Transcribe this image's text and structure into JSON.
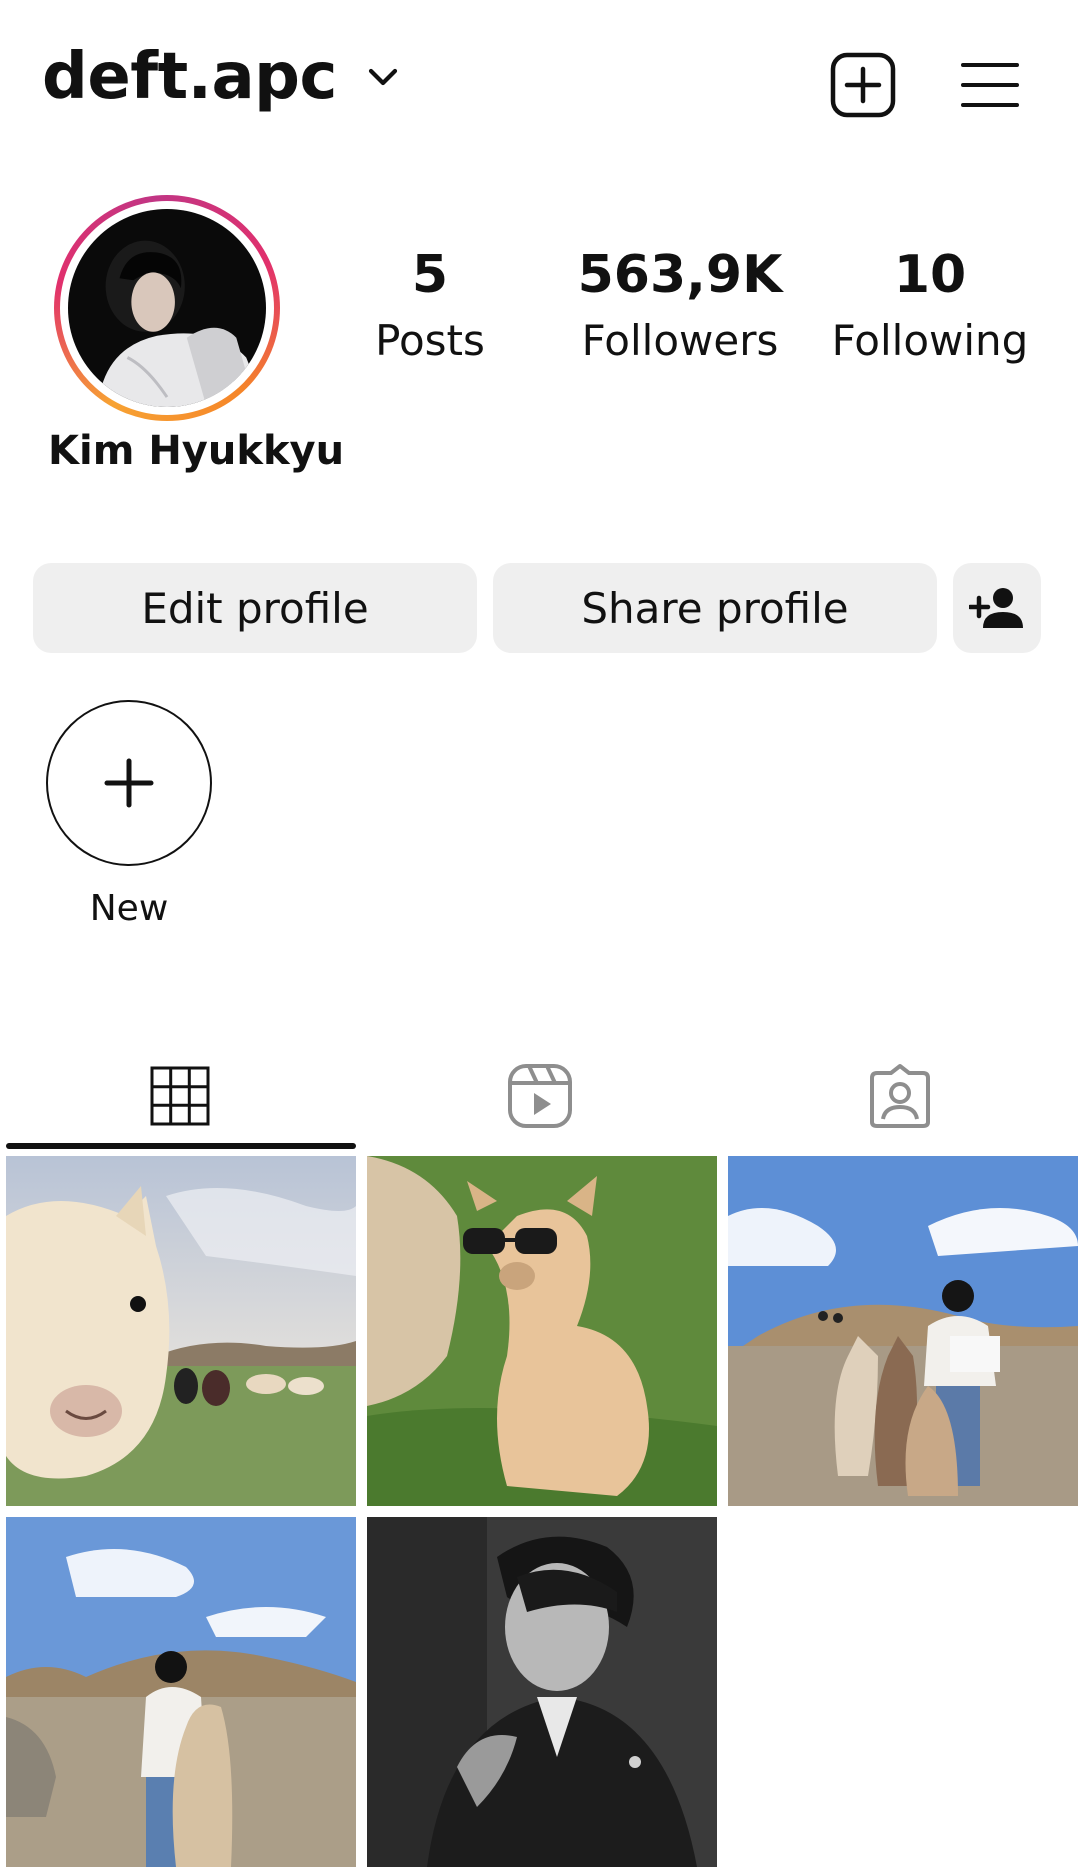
{
  "header": {
    "username": "deft.apc",
    "icons": {
      "dropdown": "chevron-down-icon",
      "create": "plus-square-icon",
      "menu": "hamburger-menu-icon"
    }
  },
  "profile": {
    "display_name": "Kim Hyukkyu",
    "avatar_icon": "profile-avatar",
    "stats": {
      "posts": {
        "count": "5",
        "label": "Posts"
      },
      "followers": {
        "count": "563,9K",
        "label": "Followers"
      },
      "following": {
        "count": "10",
        "label": "Following"
      }
    }
  },
  "actions": {
    "edit_label": "Edit profile",
    "share_label": "Share profile",
    "suggest_icon": "add-person-icon"
  },
  "highlights": {
    "new_label": "New",
    "new_icon": "plus-icon"
  },
  "tabs": [
    {
      "name": "grid",
      "icon": "grid-icon",
      "active": true
    },
    {
      "name": "reels",
      "icon": "reels-icon",
      "active": false
    },
    {
      "name": "tagged",
      "icon": "tagged-person-icon",
      "active": false
    }
  ],
  "posts": [
    {
      "subject": "alpaca close-up selfie in meadow"
    },
    {
      "subject": "alpaca wearing sunglasses"
    },
    {
      "subject": "person with alpacas under blue sky"
    },
    {
      "subject": "person petting alpaca near hills"
    },
    {
      "subject": "black and white portrait in suit"
    }
  ],
  "colors": {
    "text": "#111111",
    "button_bg": "#efefef",
    "story_ring_start": "#f7a233",
    "story_ring_end": "#c13584",
    "icon_inactive": "#8e8e8e"
  }
}
